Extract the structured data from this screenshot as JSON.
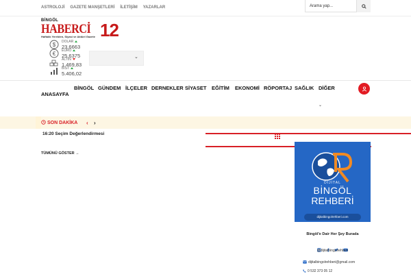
{
  "topbar": {
    "links": [
      "ASTROLOJİ",
      "GAZETE MANŞETLERİ",
      "İLETİŞİM",
      "YAZARLAR"
    ],
    "search_placeholder": "Arama yap..."
  },
  "logo": {
    "city": "BİNGÖL",
    "name": "HABERCİ",
    "number": "12",
    "tagline": "Haftalık Yerelden, Siyasi ve Aktüel Gazete"
  },
  "finance": [
    {
      "label": "DOLAR",
      "value": "23,6663",
      "trend": "up",
      "icon": "dollar-icon"
    },
    {
      "label": "EURO",
      "value": "25,6375",
      "trend": "up",
      "icon": "euro-icon"
    },
    {
      "label": "ALTIN",
      "value": "1.469,83",
      "trend": "down",
      "icon": "gold-icon"
    },
    {
      "label": "BIST",
      "value": "5.406,02",
      "trend": "up",
      "icon": "bist-icon"
    }
  ],
  "nav": {
    "items": [
      "BİNGÖL",
      "GÜNDEM",
      "İLÇELER",
      "DERNEKLER",
      "SİYASET",
      "EĞİTİM",
      "EKONOMİ",
      "RÖPORTAJ",
      "SAĞLIK",
      "DİĞER"
    ],
    "home": "ANASAYFA"
  },
  "breaking": {
    "title": "SON DAKİKA",
    "headline": "16:20 Seçim Değerlendirmesi",
    "all_link": "TÜMÜNÜ GÖSTER →"
  },
  "ad": {
    "dijital": "DİJİTAL",
    "bingol": "BİNGÖL",
    "rehber": "REHBERİ",
    "url": "dijitalbingolrehberi.com",
    "tagline": "Bingöl'e Dair Her Şey Burada",
    "handle": "@dijitalbingolrehberi",
    "email": "dijitalbingolrehberi@gmail.com",
    "phone": "0 532 373 05 12"
  },
  "colors": {
    "brand_red": "#c71a1a",
    "accent_red": "#d81f26",
    "ad_blue": "#2567c5",
    "breaking_bg": "#fdf6e3"
  }
}
